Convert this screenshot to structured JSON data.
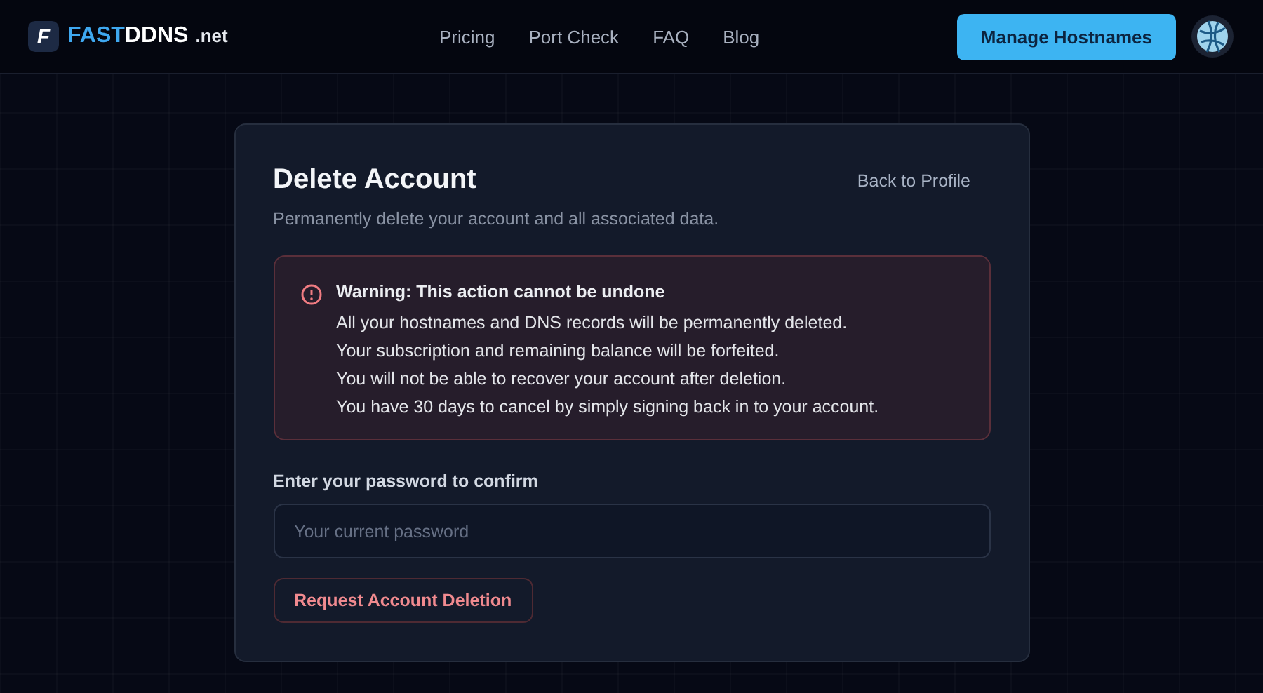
{
  "header": {
    "logo": {
      "mark": "F",
      "first": "FAST",
      "second": "DDNS",
      "suffix": ".net"
    },
    "nav": [
      "Pricing",
      "Port Check",
      "FAQ",
      "Blog"
    ],
    "cta": "Manage Hostnames"
  },
  "card": {
    "title": "Delete Account",
    "back_link": "Back to Profile",
    "subtitle": "Permanently delete your account and all associated data.",
    "warning": {
      "title": "Warning: This action cannot be undone",
      "lines": [
        "All your hostnames and DNS records will be permanently deleted.",
        "Your subscription and remaining balance will be forfeited.",
        "You will not be able to recover your account after deletion.",
        "You have 30 days to cancel by simply signing back in to your account."
      ]
    },
    "password": {
      "label": "Enter your password to confirm",
      "placeholder": "Your current password"
    },
    "submit": "Request Account Deletion"
  }
}
